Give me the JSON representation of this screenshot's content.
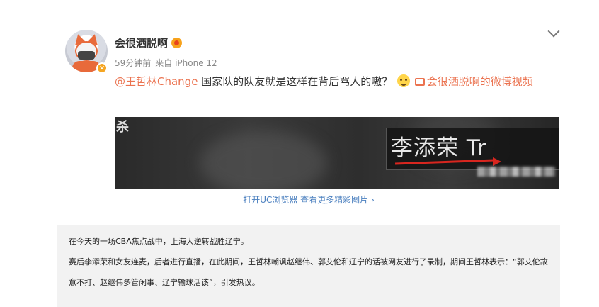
{
  "post": {
    "username": "会很洒脱啊",
    "time": "59分钟前",
    "source": "来自 iPhone 12",
    "mention": "@王哲林Change",
    "body": " 国家队的队友就是这样在背后骂人的嗷？",
    "video_link": "会很洒脱啊的微博视频",
    "video": {
      "top_char": "杀",
      "name_card": "李添荣 Tr"
    },
    "open_browser": "打开UC浏览器 查看更多精彩图片 ›",
    "icons": [
      "avatar",
      "verified-badge",
      "level-badge-icon",
      "chevron-down-icon",
      "smile-emoji-icon",
      "video-link-icon"
    ]
  },
  "article": {
    "para1": "在今天的一场CBA焦点战中，上海大逆转战胜辽宁。",
    "para2": "赛后李添荣和女友连麦，后者进行直播，在此期间，王哲林嘲讽赵继伟、郭艾伦和辽宁的话被网友进行了录制，期间王哲林表示：“郭艾伦故意不打、赵继伟多管闲事、辽宁输球活该”，引发热议。"
  },
  "colors": {
    "accent": "#eb7350",
    "link": "#4a7fbf",
    "article_bg": "#f2f2f2"
  }
}
